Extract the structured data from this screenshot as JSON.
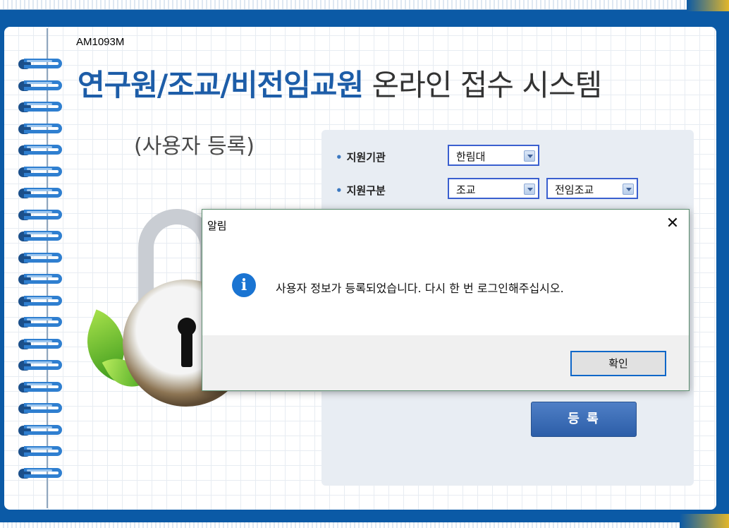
{
  "app": {
    "code": "AM1093M",
    "title_strong": "연구원/조교/비전임교원",
    "title_rest": " 온라인 접수 시스템",
    "subtitle": "(사용자 등록)"
  },
  "form": {
    "institution": {
      "label": "지원기관",
      "value": "한림대"
    },
    "category": {
      "label": "지원구분",
      "value": "조교",
      "sub_value": "전임조교"
    },
    "submit_label": "등 록"
  },
  "dialog": {
    "title": "알림",
    "close_glyph": "✕",
    "icon_glyph": "i",
    "message": "사용자 정보가 등록되었습니다. 다시 한 번 로그인해주십시오.",
    "ok_label": "확인"
  },
  "colors": {
    "frame": "#0b5aa6",
    "accent_gold": "#e2b62a",
    "title_blue": "#1d5da8",
    "info_icon": "#1a74d2",
    "ok_border": "#0f67c8"
  },
  "icons": [
    "ring-binder-icon",
    "padlock-icon",
    "leaf-icon",
    "info-icon",
    "close-icon",
    "dropdown-arrow-icon"
  ]
}
